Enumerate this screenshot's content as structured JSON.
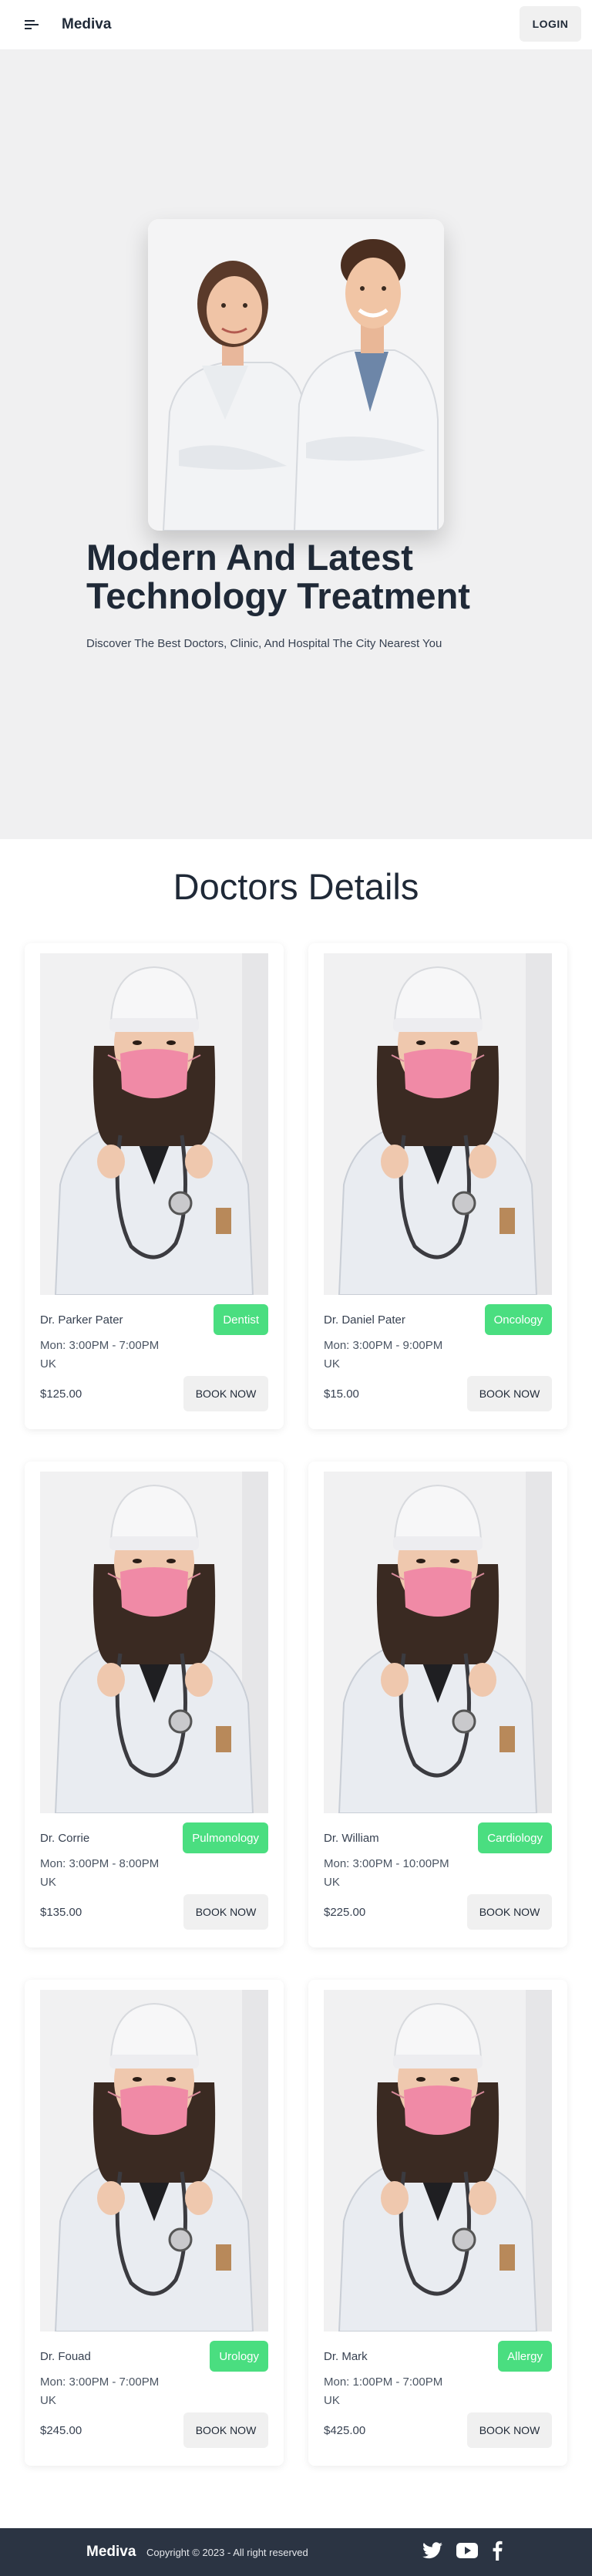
{
  "nav": {
    "brand": "Mediva",
    "login_label": "LOGIN",
    "menu_icon": "menu-icon"
  },
  "hero": {
    "title": "Modern And Latest Technology Treatment",
    "subtitle": "Discover The Best Doctors, Clinic, And Hospital The City Nearest You"
  },
  "section": {
    "title": "Doctors Details"
  },
  "doctors": [
    {
      "name": "Dr. Parker Pater",
      "specialty": "Dentist",
      "schedule": "Mon: 3:00PM - 7:00PM",
      "location": "UK",
      "price": "$125.00",
      "button": "BOOK NOW"
    },
    {
      "name": "Dr. Daniel Pater",
      "specialty": "Oncology",
      "schedule": "Mon: 3:00PM - 9:00PM",
      "location": "UK",
      "price": "$15.00",
      "button": "BOOK NOW"
    },
    {
      "name": "Dr. Corrie",
      "specialty": "Pulmonology",
      "schedule": "Mon: 3:00PM - 8:00PM",
      "location": "UK",
      "price": "$135.00",
      "button": "BOOK NOW"
    },
    {
      "name": "Dr. William",
      "specialty": "Cardiology",
      "schedule": "Mon: 3:00PM - 10:00PM",
      "location": "UK",
      "price": "$225.00",
      "button": "BOOK NOW"
    },
    {
      "name": "Dr. Fouad",
      "specialty": "Urology",
      "schedule": "Mon: 3:00PM - 7:00PM",
      "location": "UK",
      "price": "$245.00",
      "button": "BOOK NOW"
    },
    {
      "name": "Dr. Mark",
      "specialty": "Allergy",
      "schedule": "Mon: 1:00PM - 7:00PM",
      "location": "UK",
      "price": "$425.00",
      "button": "BOOK NOW"
    }
  ],
  "footer": {
    "brand": "Mediva",
    "copyright": "Copyright © 2023 - All right reserved",
    "social_icons": [
      "twitter-icon",
      "youtube-icon",
      "facebook-icon"
    ]
  },
  "colors": {
    "accent_badge": "#4ade80",
    "footer_bg": "#2b3443",
    "hero_bg": "#f0f0f1",
    "mask_pink": "#f08aa6"
  }
}
